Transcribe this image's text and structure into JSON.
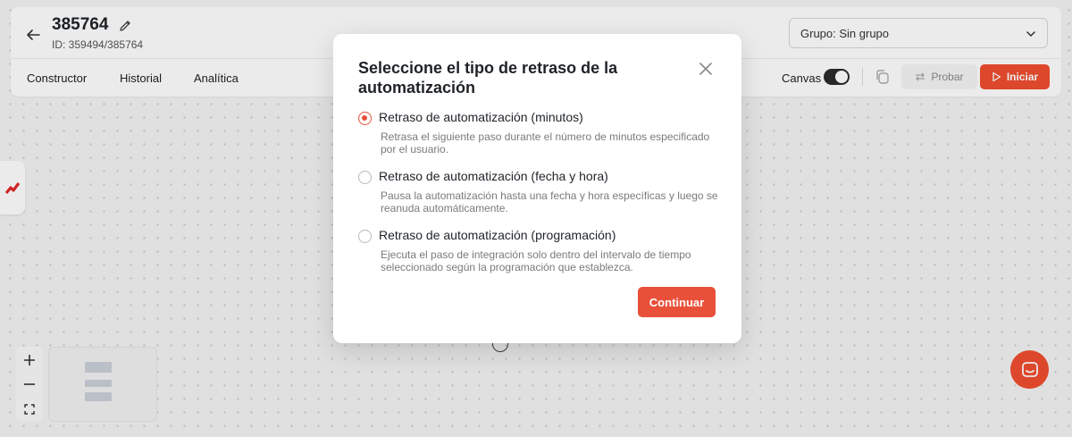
{
  "header": {
    "title": "385764",
    "id_text": "ID: 359494/385764",
    "group_select_value": "Grupo: Sin grupo"
  },
  "tabs": [
    {
      "label": "Constructor"
    },
    {
      "label": "Historial"
    },
    {
      "label": "Analítica"
    }
  ],
  "toolbar": {
    "canvas_label": "Canvas",
    "canvas_toggle_on": true,
    "probar_label": "Probar",
    "iniciar_label": "Iniciar"
  },
  "colors": {
    "accent": "#f04e2f",
    "modal_accent": "#e9503a"
  },
  "modal": {
    "title": "Seleccione el tipo de retraso de la automatización",
    "options": [
      {
        "label": "Retraso de automatización (minutos)",
        "description": "Retrasa el siguiente paso durante el número de minutos especificado por el usuario.",
        "selected": true
      },
      {
        "label": "Retraso de automatización (fecha y hora)",
        "description": "Pausa la automatización hasta una fecha y hora específicas y luego se reanuda automáticamente.",
        "selected": false
      },
      {
        "label": "Retraso de automatización (programación)",
        "description": "Ejecuta el paso de integración solo dentro del intervalo de tiempo seleccionado según la programación que establezca.",
        "selected": false
      }
    ],
    "continue_label": "Continuar"
  },
  "icons": {
    "back": "arrow-left-icon",
    "edit": "pencil-icon",
    "chevron": "chevron-down-icon",
    "copy": "copy-icon",
    "probar": "swap-arrows-icon",
    "iniciar": "play-icon",
    "close": "close-icon",
    "chat": "chat-icon",
    "zoom_in": "plus-icon",
    "zoom_out": "minus-icon",
    "fit": "fit-screen-icon",
    "side": "logo-icon"
  }
}
